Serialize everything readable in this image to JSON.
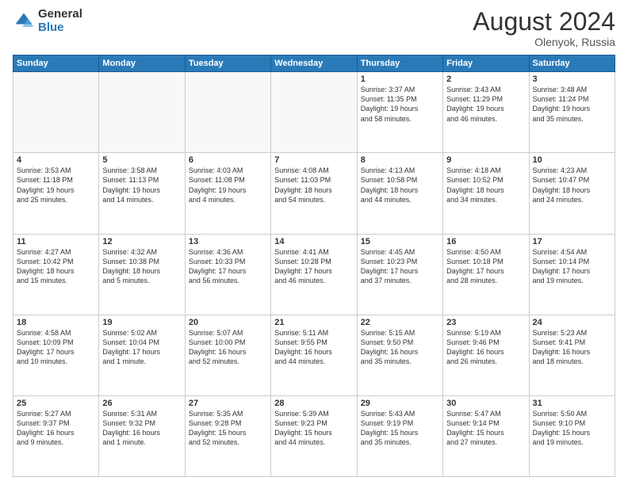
{
  "header": {
    "logo_general": "General",
    "logo_blue": "Blue",
    "title": "August 2024",
    "location": "Olenyok, Russia"
  },
  "days_of_week": [
    "Sunday",
    "Monday",
    "Tuesday",
    "Wednesday",
    "Thursday",
    "Friday",
    "Saturday"
  ],
  "weeks": [
    [
      {
        "day": "",
        "info": ""
      },
      {
        "day": "",
        "info": ""
      },
      {
        "day": "",
        "info": ""
      },
      {
        "day": "",
        "info": ""
      },
      {
        "day": "1",
        "info": "Sunrise: 3:37 AM\nSunset: 11:35 PM\nDaylight: 19 hours\nand 58 minutes."
      },
      {
        "day": "2",
        "info": "Sunrise: 3:43 AM\nSunset: 11:29 PM\nDaylight: 19 hours\nand 46 minutes."
      },
      {
        "day": "3",
        "info": "Sunrise: 3:48 AM\nSunset: 11:24 PM\nDaylight: 19 hours\nand 35 minutes."
      }
    ],
    [
      {
        "day": "4",
        "info": "Sunrise: 3:53 AM\nSunset: 11:18 PM\nDaylight: 19 hours\nand 25 minutes."
      },
      {
        "day": "5",
        "info": "Sunrise: 3:58 AM\nSunset: 11:13 PM\nDaylight: 19 hours\nand 14 minutes."
      },
      {
        "day": "6",
        "info": "Sunrise: 4:03 AM\nSunset: 11:08 PM\nDaylight: 19 hours\nand 4 minutes."
      },
      {
        "day": "7",
        "info": "Sunrise: 4:08 AM\nSunset: 11:03 PM\nDaylight: 18 hours\nand 54 minutes."
      },
      {
        "day": "8",
        "info": "Sunrise: 4:13 AM\nSunset: 10:58 PM\nDaylight: 18 hours\nand 44 minutes."
      },
      {
        "day": "9",
        "info": "Sunrise: 4:18 AM\nSunset: 10:52 PM\nDaylight: 18 hours\nand 34 minutes."
      },
      {
        "day": "10",
        "info": "Sunrise: 4:23 AM\nSunset: 10:47 PM\nDaylight: 18 hours\nand 24 minutes."
      }
    ],
    [
      {
        "day": "11",
        "info": "Sunrise: 4:27 AM\nSunset: 10:42 PM\nDaylight: 18 hours\nand 15 minutes."
      },
      {
        "day": "12",
        "info": "Sunrise: 4:32 AM\nSunset: 10:38 PM\nDaylight: 18 hours\nand 5 minutes."
      },
      {
        "day": "13",
        "info": "Sunrise: 4:36 AM\nSunset: 10:33 PM\nDaylight: 17 hours\nand 56 minutes."
      },
      {
        "day": "14",
        "info": "Sunrise: 4:41 AM\nSunset: 10:28 PM\nDaylight: 17 hours\nand 46 minutes."
      },
      {
        "day": "15",
        "info": "Sunrise: 4:45 AM\nSunset: 10:23 PM\nDaylight: 17 hours\nand 37 minutes."
      },
      {
        "day": "16",
        "info": "Sunrise: 4:50 AM\nSunset: 10:18 PM\nDaylight: 17 hours\nand 28 minutes."
      },
      {
        "day": "17",
        "info": "Sunrise: 4:54 AM\nSunset: 10:14 PM\nDaylight: 17 hours\nand 19 minutes."
      }
    ],
    [
      {
        "day": "18",
        "info": "Sunrise: 4:58 AM\nSunset: 10:09 PM\nDaylight: 17 hours\nand 10 minutes."
      },
      {
        "day": "19",
        "info": "Sunrise: 5:02 AM\nSunset: 10:04 PM\nDaylight: 17 hours\nand 1 minute."
      },
      {
        "day": "20",
        "info": "Sunrise: 5:07 AM\nSunset: 10:00 PM\nDaylight: 16 hours\nand 52 minutes."
      },
      {
        "day": "21",
        "info": "Sunrise: 5:11 AM\nSunset: 9:55 PM\nDaylight: 16 hours\nand 44 minutes."
      },
      {
        "day": "22",
        "info": "Sunrise: 5:15 AM\nSunset: 9:50 PM\nDaylight: 16 hours\nand 35 minutes."
      },
      {
        "day": "23",
        "info": "Sunrise: 5:19 AM\nSunset: 9:46 PM\nDaylight: 16 hours\nand 26 minutes."
      },
      {
        "day": "24",
        "info": "Sunrise: 5:23 AM\nSunset: 9:41 PM\nDaylight: 16 hours\nand 18 minutes."
      }
    ],
    [
      {
        "day": "25",
        "info": "Sunrise: 5:27 AM\nSunset: 9:37 PM\nDaylight: 16 hours\nand 9 minutes."
      },
      {
        "day": "26",
        "info": "Sunrise: 5:31 AM\nSunset: 9:32 PM\nDaylight: 16 hours\nand 1 minute."
      },
      {
        "day": "27",
        "info": "Sunrise: 5:35 AM\nSunset: 9:28 PM\nDaylight: 15 hours\nand 52 minutes."
      },
      {
        "day": "28",
        "info": "Sunrise: 5:39 AM\nSunset: 9:23 PM\nDaylight: 15 hours\nand 44 minutes."
      },
      {
        "day": "29",
        "info": "Sunrise: 5:43 AM\nSunset: 9:19 PM\nDaylight: 15 hours\nand 35 minutes."
      },
      {
        "day": "30",
        "info": "Sunrise: 5:47 AM\nSunset: 9:14 PM\nDaylight: 15 hours\nand 27 minutes."
      },
      {
        "day": "31",
        "info": "Sunrise: 5:50 AM\nSunset: 9:10 PM\nDaylight: 15 hours\nand 19 minutes."
      }
    ]
  ]
}
